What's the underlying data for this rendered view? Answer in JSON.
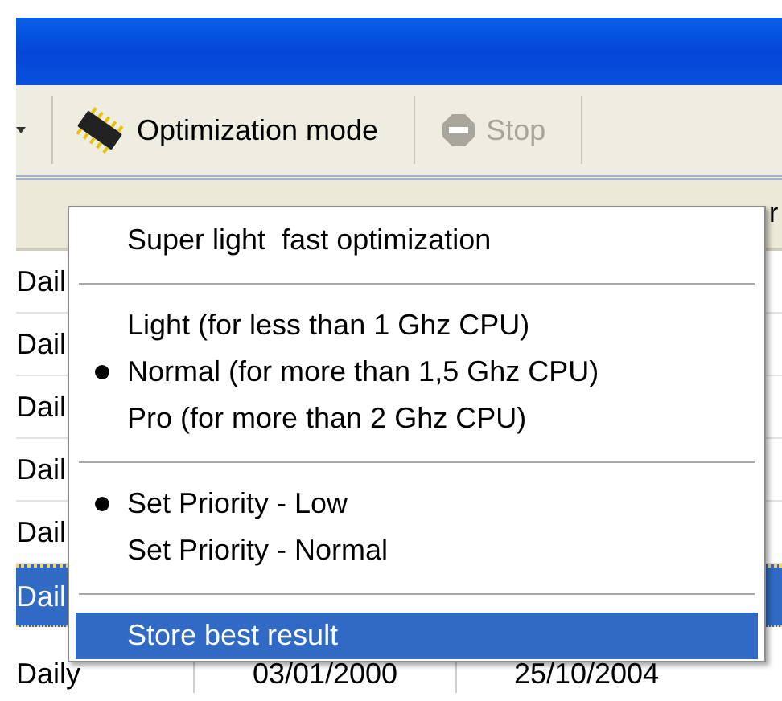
{
  "toolbar": {
    "buttons": [
      {
        "label": "Optimization mode",
        "disabled": false,
        "kind": "chip"
      },
      {
        "label": "Stop",
        "disabled": true,
        "kind": "stop"
      }
    ]
  },
  "list": {
    "header": [
      "r"
    ],
    "rows": [
      {
        "cells": [
          "Dail"
        ],
        "selected": false
      },
      {
        "cells": [
          "Dail"
        ],
        "selected": false
      },
      {
        "cells": [
          "Dail"
        ],
        "selected": false
      },
      {
        "cells": [
          "Dail"
        ],
        "selected": false
      },
      {
        "cells": [
          "Dail"
        ],
        "selected": false
      },
      {
        "cells": [
          "Dail"
        ],
        "selected": true
      },
      {
        "cells": [
          "Daily",
          "03/01/2000",
          "25/10/2004"
        ],
        "selected": false
      }
    ]
  },
  "menu": {
    "items": [
      {
        "kind": "item",
        "label": "Super light  fast optimization",
        "checked": false,
        "selected": false
      },
      {
        "kind": "separator"
      },
      {
        "kind": "item",
        "label": "Light (for less than 1 Ghz CPU)",
        "checked": false,
        "selected": false
      },
      {
        "kind": "item",
        "label": "Normal (for more than 1,5 Ghz CPU)",
        "checked": true,
        "selected": false
      },
      {
        "kind": "item",
        "label": "Pro (for more than 2 Ghz CPU)",
        "checked": false,
        "selected": false
      },
      {
        "kind": "separator"
      },
      {
        "kind": "item",
        "label": "Set Priority - Low",
        "checked": true,
        "selected": false
      },
      {
        "kind": "item",
        "label": "Set Priority - Normal",
        "checked": false,
        "selected": false
      },
      {
        "kind": "separator"
      },
      {
        "kind": "item",
        "label": "Store best result",
        "checked": false,
        "selected": true
      }
    ]
  }
}
